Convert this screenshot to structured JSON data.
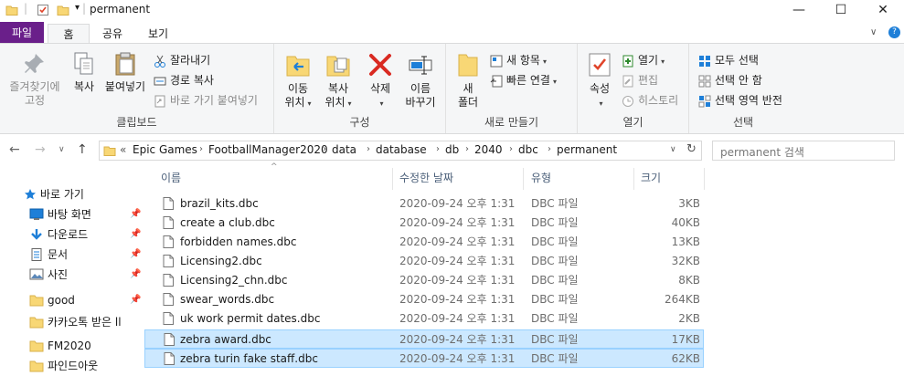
{
  "window": {
    "title": "permanent",
    "controls": {
      "minimize": "—",
      "maximize": "☐",
      "close": "✕"
    }
  },
  "ribbon_tabs": {
    "file": "파일",
    "home": "홈",
    "share": "공유",
    "view": "보기"
  },
  "ribbon": {
    "clipboard": {
      "label": "클립보드",
      "pin_quick_access": [
        "즐겨찾기에",
        "고정"
      ],
      "copy": "복사",
      "paste": "붙여넣기",
      "cut": "잘라내기",
      "copy_path": "경로 복사",
      "paste_shortcut": "바로 가기 붙여넣기"
    },
    "organize": {
      "label": "구성",
      "move_to": [
        "이동",
        "위치"
      ],
      "copy_to": [
        "복사",
        "위치"
      ],
      "delete": "삭제",
      "rename": [
        "이름",
        "바꾸기"
      ]
    },
    "new": {
      "label": "새로 만들기",
      "new_folder": [
        "새",
        "폴더"
      ],
      "new_item": "새 항목",
      "easy_access": "빠른 연결"
    },
    "open": {
      "label": "열기",
      "properties": "속성",
      "open": "열기",
      "edit": "편집",
      "history": "히스토리"
    },
    "select": {
      "label": "선택",
      "select_all": "모두 선택",
      "select_none": "선택 안 함",
      "invert_selection": "선택 영역 반전"
    }
  },
  "address": {
    "overflow": "«",
    "crumbs": [
      "Epic Games",
      "FootballManager2020",
      "data",
      "database",
      "db",
      "2040",
      "dbc",
      "permanent"
    ],
    "search_placeholder": "permanent 검색"
  },
  "nav_pane": {
    "items": [
      {
        "label": "바로 가기",
        "icon": "star-icon",
        "pinned": false
      },
      {
        "label": "바탕 화면",
        "icon": "desktop-icon",
        "pinned": true
      },
      {
        "label": "다운로드",
        "icon": "download-icon",
        "pinned": true
      },
      {
        "label": "문서",
        "icon": "document-icon",
        "pinned": true
      },
      {
        "label": "사진",
        "icon": "pictures-icon",
        "pinned": true
      },
      {
        "label": "good",
        "icon": "folder-icon",
        "pinned": true
      },
      {
        "label": "카카오톡 받은 ll",
        "icon": "folder-icon",
        "pinned": false
      },
      {
        "label": "FM2020",
        "icon": "folder-icon",
        "pinned": false
      },
      {
        "label": "파인드아웃",
        "icon": "folder-icon",
        "pinned": false
      }
    ]
  },
  "columns": {
    "name": "이름",
    "modified": "수정한 날짜",
    "type": "유형",
    "size": "크기"
  },
  "files": [
    {
      "name": "brazil_kits.dbc",
      "modified": "2020-09-24 오후 1:31",
      "type": "DBC 파일",
      "size": "3KB",
      "selected": false
    },
    {
      "name": "create a club.dbc",
      "modified": "2020-09-24 오후 1:31",
      "type": "DBC 파일",
      "size": "40KB",
      "selected": false
    },
    {
      "name": "forbidden names.dbc",
      "modified": "2020-09-24 오후 1:31",
      "type": "DBC 파일",
      "size": "13KB",
      "selected": false
    },
    {
      "name": "Licensing2.dbc",
      "modified": "2020-09-24 오후 1:31",
      "type": "DBC 파일",
      "size": "32KB",
      "selected": false
    },
    {
      "name": "Licensing2_chn.dbc",
      "modified": "2020-09-24 오후 1:31",
      "type": "DBC 파일",
      "size": "8KB",
      "selected": false
    },
    {
      "name": "swear_words.dbc",
      "modified": "2020-09-24 오후 1:31",
      "type": "DBC 파일",
      "size": "264KB",
      "selected": false
    },
    {
      "name": "uk work permit dates.dbc",
      "modified": "2020-09-24 오후 1:31",
      "type": "DBC 파일",
      "size": "2KB",
      "selected": false
    },
    {
      "name": "zebra award.dbc",
      "modified": "2020-09-24 오후 1:31",
      "type": "DBC 파일",
      "size": "17KB",
      "selected": true
    },
    {
      "name": "zebra turin fake staff.dbc",
      "modified": "2020-09-24 오후 1:31",
      "type": "DBC 파일",
      "size": "62KB",
      "selected": true
    }
  ],
  "colors": {
    "file_tab": "#6a1f8a",
    "selection": "#cce8ff",
    "selection_border": "#99d1ff",
    "folder": "#f8d775",
    "accent_blue": "#1e7fd8"
  }
}
